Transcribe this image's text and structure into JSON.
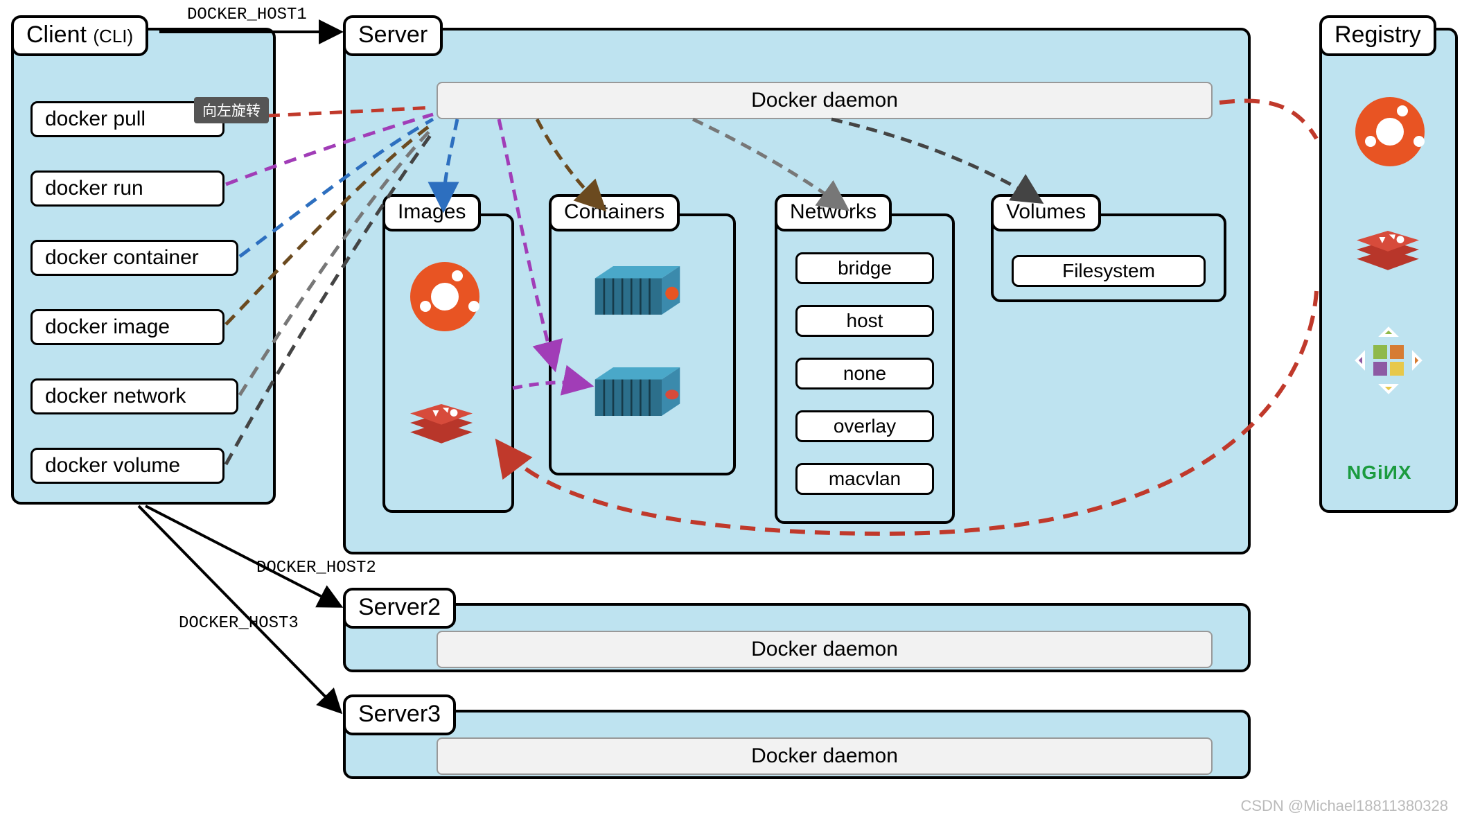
{
  "client": {
    "title": "Client",
    "subtitle": "(CLI)",
    "commands": [
      "docker pull",
      "docker run",
      "docker container",
      "docker image",
      "docker network",
      "docker volume"
    ]
  },
  "server": {
    "title": "Server",
    "daemon": "Docker daemon",
    "sections": {
      "images": "Images",
      "containers": "Containers",
      "networks": "Networks",
      "volumes": "Volumes"
    },
    "networks_list": [
      "bridge",
      "host",
      "none",
      "overlay",
      "macvlan"
    ],
    "volumes_list": [
      "Filesystem"
    ]
  },
  "server2": {
    "title": "Server2",
    "daemon": "Docker daemon"
  },
  "server3": {
    "title": "Server3",
    "daemon": "Docker daemon"
  },
  "registry": {
    "title": "Registry",
    "nginx": "NGiИX"
  },
  "edges": {
    "host1": "DOCKER_HOST1",
    "host2": "DOCKER_HOST2",
    "host3": "DOCKER_HOST3"
  },
  "tooltip": "向左旋转",
  "watermark": "CSDN @Michael18811380328"
}
